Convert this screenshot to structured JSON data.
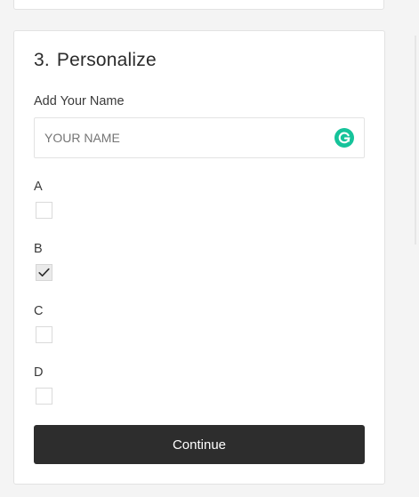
{
  "section": {
    "number": "3.",
    "title": "Personalize"
  },
  "name_field": {
    "label": "Add Your Name",
    "placeholder": "YOUR NAME",
    "icon": "grammarly-icon"
  },
  "options": [
    {
      "label": "A",
      "checked": false
    },
    {
      "label": "B",
      "checked": true
    },
    {
      "label": "C",
      "checked": false
    },
    {
      "label": "D",
      "checked": false
    }
  ],
  "continue_label": "Continue",
  "colors": {
    "button": "#2d2d2d",
    "grammarly": "#15c39a",
    "checked_box": "#eaeaea"
  }
}
